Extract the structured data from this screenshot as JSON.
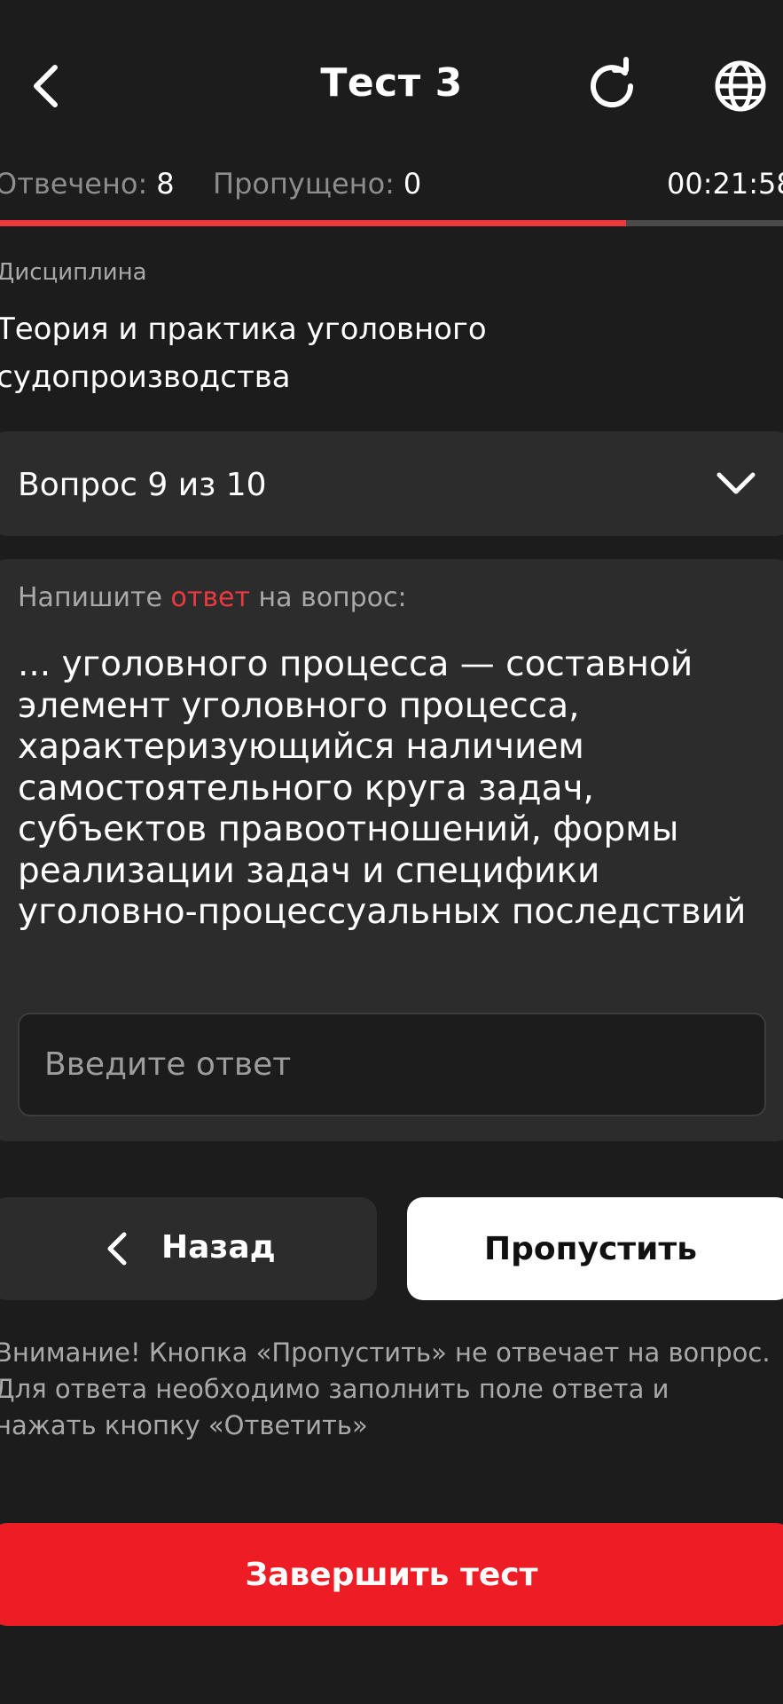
{
  "header": {
    "title": "Тест 3",
    "back_icon": "chevron-left-icon",
    "refresh_icon": "refresh-icon",
    "language_icon": "globe-icon"
  },
  "stats": {
    "answered_label": "Отвечено:",
    "answered_value": "8",
    "skipped_label": "Пропущено:",
    "skipped_value": "0",
    "timer": "00:21:58"
  },
  "progress": {
    "fraction": 0.8
  },
  "discipline": {
    "label": "Дисциплина",
    "name": "Теория и практика уголовного судопроизводства"
  },
  "question_selector": {
    "label": "Вопрос 9 из 10",
    "icon": "chevron-down-icon"
  },
  "question": {
    "instruction_prefix": "Напишите",
    "instruction_accent": "ответ",
    "instruction_suffix": "на вопрос:",
    "text": "... уголовного процесса — составной элемент уголовного процесса, характеризующийся наличием самостоятельного круга задач, субъектов правоотношений, формы реализации задач и специфики уголовно-процессуальных последствий"
  },
  "answer": {
    "value": "",
    "placeholder": "Введите ответ"
  },
  "buttons": {
    "back_label": "Назад",
    "skip_label": "Пропустить",
    "finish_label": "Завершить тест"
  },
  "notice": "Внимание! Кнопка «Пропустить» не отвечает на вопрос. Для ответа необходимо заполнить поле ответа и нажать кнопку «Ответить»",
  "colors": {
    "background": "#1c1c1c",
    "card": "#2c2c2c",
    "accent_red": "#ee1c24",
    "progress_red": "#ee3a3f",
    "muted_text": "#a9a9a9"
  }
}
